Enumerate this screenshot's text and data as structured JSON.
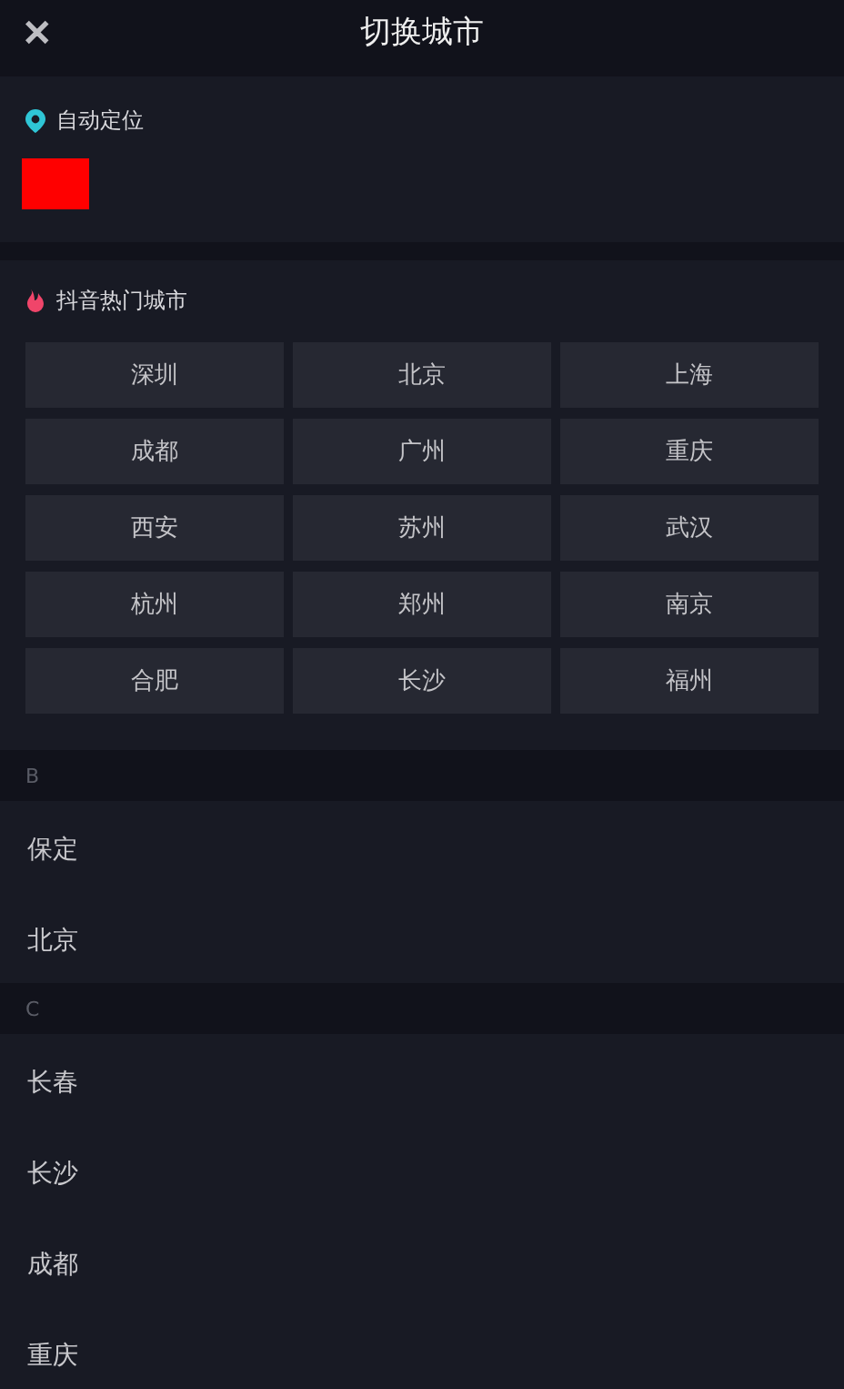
{
  "header": {
    "close": "✕",
    "title": "切换城市"
  },
  "location": {
    "label": "自动定位"
  },
  "hot": {
    "label": "抖音热门城市",
    "cities": [
      "深圳",
      "北京",
      "上海",
      "成都",
      "广州",
      "重庆",
      "西安",
      "苏州",
      "武汉",
      "杭州",
      "郑州",
      "南京",
      "合肥",
      "长沙",
      "福州"
    ]
  },
  "groups": [
    {
      "letter": "B",
      "cities": [
        "保定",
        "北京"
      ]
    },
    {
      "letter": "C",
      "cities": [
        "长春",
        "长沙",
        "成都",
        "重庆"
      ]
    }
  ]
}
